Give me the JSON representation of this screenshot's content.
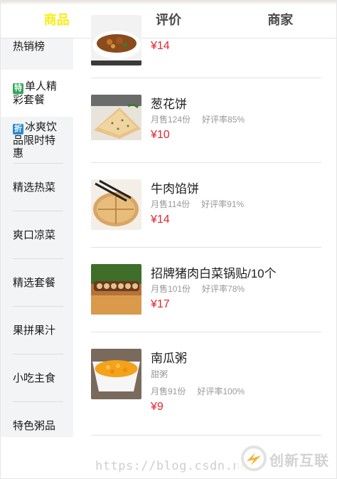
{
  "tabs": [
    {
      "label": "商品",
      "active": true
    },
    {
      "label": "评价",
      "active": false
    },
    {
      "label": "商家",
      "active": false
    }
  ],
  "sidebar": {
    "items": [
      {
        "label": "热销榜",
        "tag": null
      },
      {
        "label": "单人精彩套餐",
        "tag": "特",
        "active": true
      },
      {
        "label": "冰爽饮品限时特惠",
        "tag": "折"
      },
      {
        "label": "精选热菜",
        "tag": null
      },
      {
        "label": "爽口凉菜",
        "tag": null
      },
      {
        "label": "精选套餐",
        "tag": null
      },
      {
        "label": "果拼果汁",
        "tag": null
      },
      {
        "label": "小吃主食",
        "tag": null
      },
      {
        "label": "特色粥品",
        "tag": null
      }
    ]
  },
  "foods": [
    {
      "name": "",
      "price": "¥14"
    },
    {
      "name": "葱花饼",
      "sales": "月售124份",
      "rating": "好评率85%",
      "price": "¥10"
    },
    {
      "name": "牛肉馅饼",
      "sales": "月售114份",
      "rating": "好评率91%",
      "price": "¥14"
    },
    {
      "name": "招牌猪肉白菜锅贴/10个",
      "sales": "月售101份",
      "rating": "好评率78%",
      "price": "¥17"
    },
    {
      "name": "南瓜粥",
      "desc": "甜粥",
      "sales": "月售91份",
      "rating": "好评率100%",
      "price": "¥9"
    }
  ],
  "watermark": {
    "url": "https://blog.csdn.ne",
    "brand": "创新互联"
  },
  "colors": {
    "active_tab": "#f7ee12",
    "price": "#e5252e",
    "sidebar_bg": "#f3f4f5",
    "tag_special": "#2ea65a",
    "tag_discount": "#2b8acd"
  }
}
